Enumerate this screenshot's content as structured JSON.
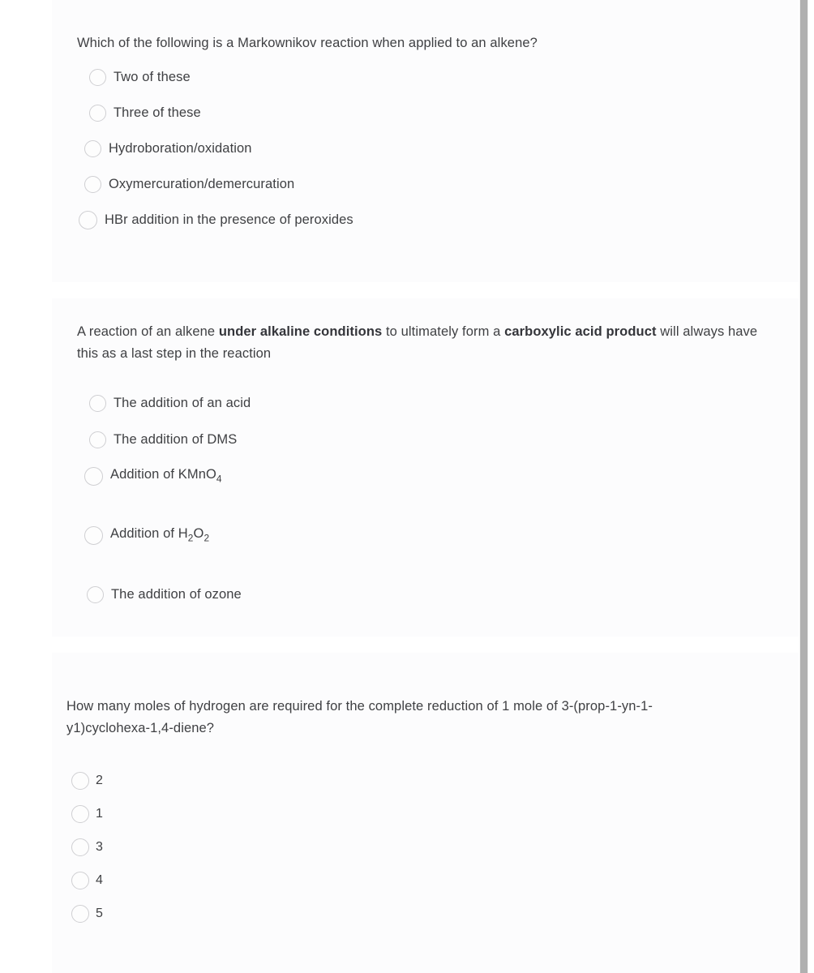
{
  "page": {
    "background_color": "#ffffff",
    "panel_color": "#fcfcfd",
    "text_color": "#3f4043",
    "radio_border_color": "#cfcfd2",
    "scrollbar_color": "#b0b0b0"
  },
  "questions": [
    {
      "id": "q1",
      "prompt": "Which of the following is a Markownikov reaction when applied to an alkene?",
      "prompt_html": "Which of the following is a Markownikov reaction when applied to an alkene?",
      "options": [
        {
          "label": "Two of these",
          "html": "Two of these",
          "selected": false
        },
        {
          "label": "Three of these",
          "html": "Three of these",
          "selected": false
        },
        {
          "label": "Hydroboration/oxidation",
          "html": "Hydroboration/oxidation",
          "selected": false
        },
        {
          "label": "Oxymercuration/demercuration",
          "html": "Oxymercuration/demercuration",
          "selected": false
        },
        {
          "label": "HBr addition in the presence of peroxides",
          "html": "HBr addition in the presence of peroxides",
          "selected": false
        }
      ]
    },
    {
      "id": "q2",
      "prompt": "A reaction of an alkene under alkaline conditions to ultimately form a carboxylic acid product will always have this as a last step in the reaction",
      "prompt_html": "A reaction of an alkene <b>under alkaline conditions</b> to ultimately form a <b>carboxylic acid product</b> will always have this as a last step in the reaction",
      "options": [
        {
          "label": "The addition of an acid",
          "html": "The addition of an acid",
          "selected": false
        },
        {
          "label": "The addition of DMS",
          "html": "The addition of DMS",
          "selected": false
        },
        {
          "label": "Addition of KMnO4",
          "html": "Addition of KMnO<sub>4</sub>",
          "selected": false
        },
        {
          "label": "Addition of H2O2",
          "html": "Addition of H<sub>2</sub>O<sub>2</sub>",
          "selected": false
        },
        {
          "label": "The addition of ozone",
          "html": "The addition of ozone",
          "selected": false
        }
      ]
    },
    {
      "id": "q3",
      "prompt": "How many moles of hydrogen are required for the complete reduction of 1 mole of 3-(prop-1-yn-1-y1)cyclohexa-1,4-diene?",
      "prompt_html": "How many moles of hydrogen are required for the complete reduction of 1 mole of 3-(prop-1-yn-1-y1)cyclohexa-1,4-diene?",
      "options": [
        {
          "label": "2",
          "html": "2",
          "selected": false
        },
        {
          "label": "1",
          "html": "1",
          "selected": false
        },
        {
          "label": "3",
          "html": "3",
          "selected": false
        },
        {
          "label": "4",
          "html": "4",
          "selected": false
        },
        {
          "label": "5",
          "html": "5",
          "selected": false
        }
      ]
    }
  ]
}
